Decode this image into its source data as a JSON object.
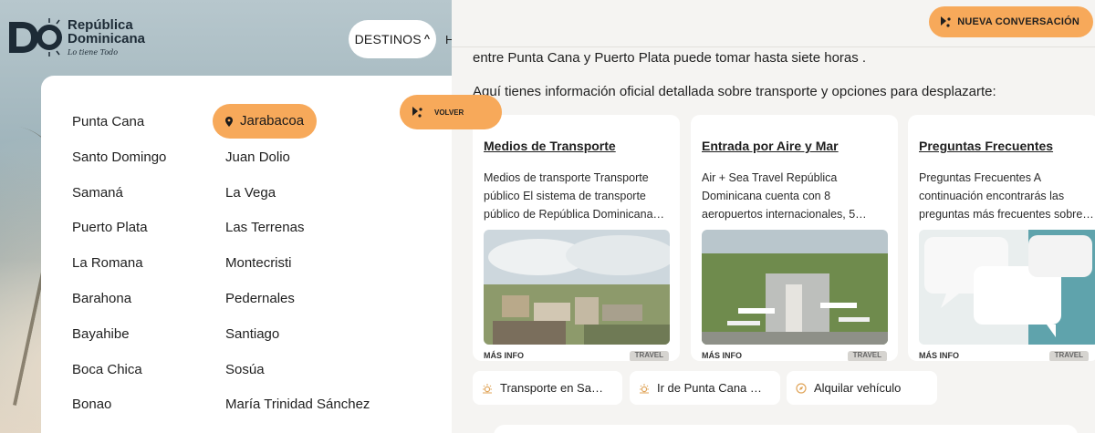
{
  "site": {
    "brand_line1": "República",
    "brand_line2": "Dominicana",
    "brand_tagline": "Lo tiene Todo",
    "nav_destinos": "DESTINOS",
    "nav_next_partial": "H"
  },
  "destinations": {
    "column1": [
      "Punta Cana",
      "Santo Domingo",
      "Samaná",
      "Puerto Plata",
      "La Romana",
      "Barahona",
      "Bayahibe",
      "Boca Chica",
      "Bonao"
    ],
    "column2": [
      "Jarabacoa",
      "Juan Dolio",
      "La Vega",
      "Las Terrenas",
      "Montecristi",
      "Pedernales",
      "Santiago",
      "Sosúa",
      "María Trinidad Sánchez"
    ],
    "selected": "Jarabacoa"
  },
  "chat": {
    "back_button": "VOLVER",
    "new_conversation_button": "NUEVA CONVERSACIÓN",
    "message_line1": "entre Punta Cana y Puerto Plata puede tomar hasta siete horas .",
    "message_line2": "Aquí tienes información oficial detallada sobre transporte y opciones para desplazarte:",
    "cards": [
      {
        "title": "Medios de Transporte",
        "description": "Medios de transporte Transporte público El sistema de transporte público de República Dominicana…",
        "footer": "MÁS INFO",
        "badge": "TRAVEL"
      },
      {
        "title": "Entrada por Aire y Mar",
        "description": "Air + Sea Travel República Dominicana cuenta con 8 aeropuertos internacionales, 5…",
        "footer": "MÁS INFO",
        "badge": "TRAVEL"
      },
      {
        "title": "Preguntas Frecuentes",
        "description": "Preguntas Frecuentes A continuación encontrarás las preguntas más frecuentes sobre…",
        "footer": "MÁS INFO",
        "badge": "TRAVEL"
      }
    ],
    "suggestions": [
      "Transporte en Sa…",
      "Ir de Punta Cana …",
      "Alquilar vehículo"
    ]
  },
  "colors": {
    "accent_orange": "#f7a95a",
    "panel_bg": "#f5f4f2",
    "card_bg": "#ffffff",
    "text_dark": "#1f1f1f"
  },
  "icons": {
    "brand_logo": "do-logo-icon",
    "chevron": "chevron-up-icon",
    "pin": "map-pin-icon",
    "spark": "spark-icon",
    "sun": "sun-icon",
    "compass": "compass-icon"
  }
}
